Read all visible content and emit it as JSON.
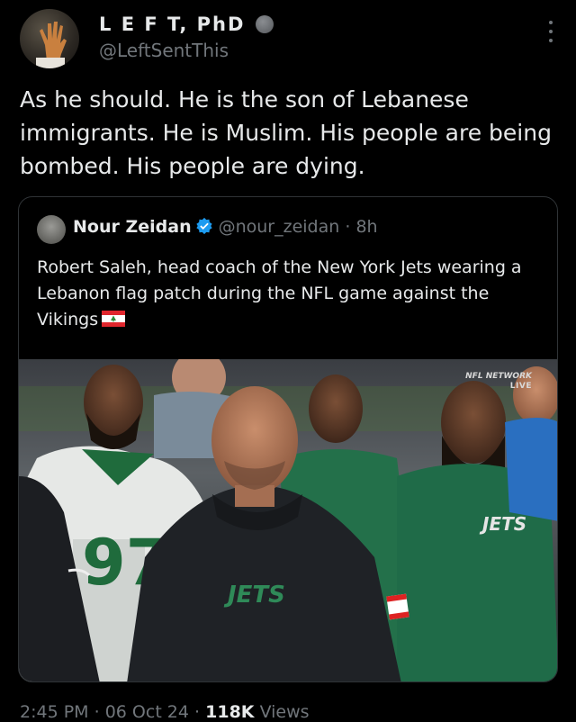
{
  "author": {
    "display_name": "L E F T, PhD",
    "handle": "@LeftSentThis"
  },
  "tweet_text": "As he should. He is the son of Lebanese immigrants. He is Muslim. His people are being bombed. His people are dying.",
  "quoted_tweet": {
    "author_name": "Nour Zeidan",
    "author_handle": "@nour_zeidan",
    "separator": "·",
    "time_ago": "8h",
    "text": "Robert Saleh, head coach of the New York Jets wearing a Lebanon flag patch during the NFL game against the Vikings",
    "flag_icon": "lebanon-flag-emoji",
    "media": {
      "overlay_logo": "NFL NETWORK",
      "overlay_live": "LIVE",
      "hoodie_text": "JETS",
      "jacket_text": "JETS",
      "jersey_number": "97"
    }
  },
  "footer": {
    "time": "2:45 PM",
    "date": "06 Oct 24",
    "views_count": "118K",
    "views_label": "Views",
    "separator": "·"
  },
  "colors": {
    "background": "#000000",
    "text_primary": "#e7e9ea",
    "text_secondary": "#71767b",
    "border": "#2f3336",
    "verified_blue": "#1d9bf0",
    "jets_green": "#125740"
  }
}
